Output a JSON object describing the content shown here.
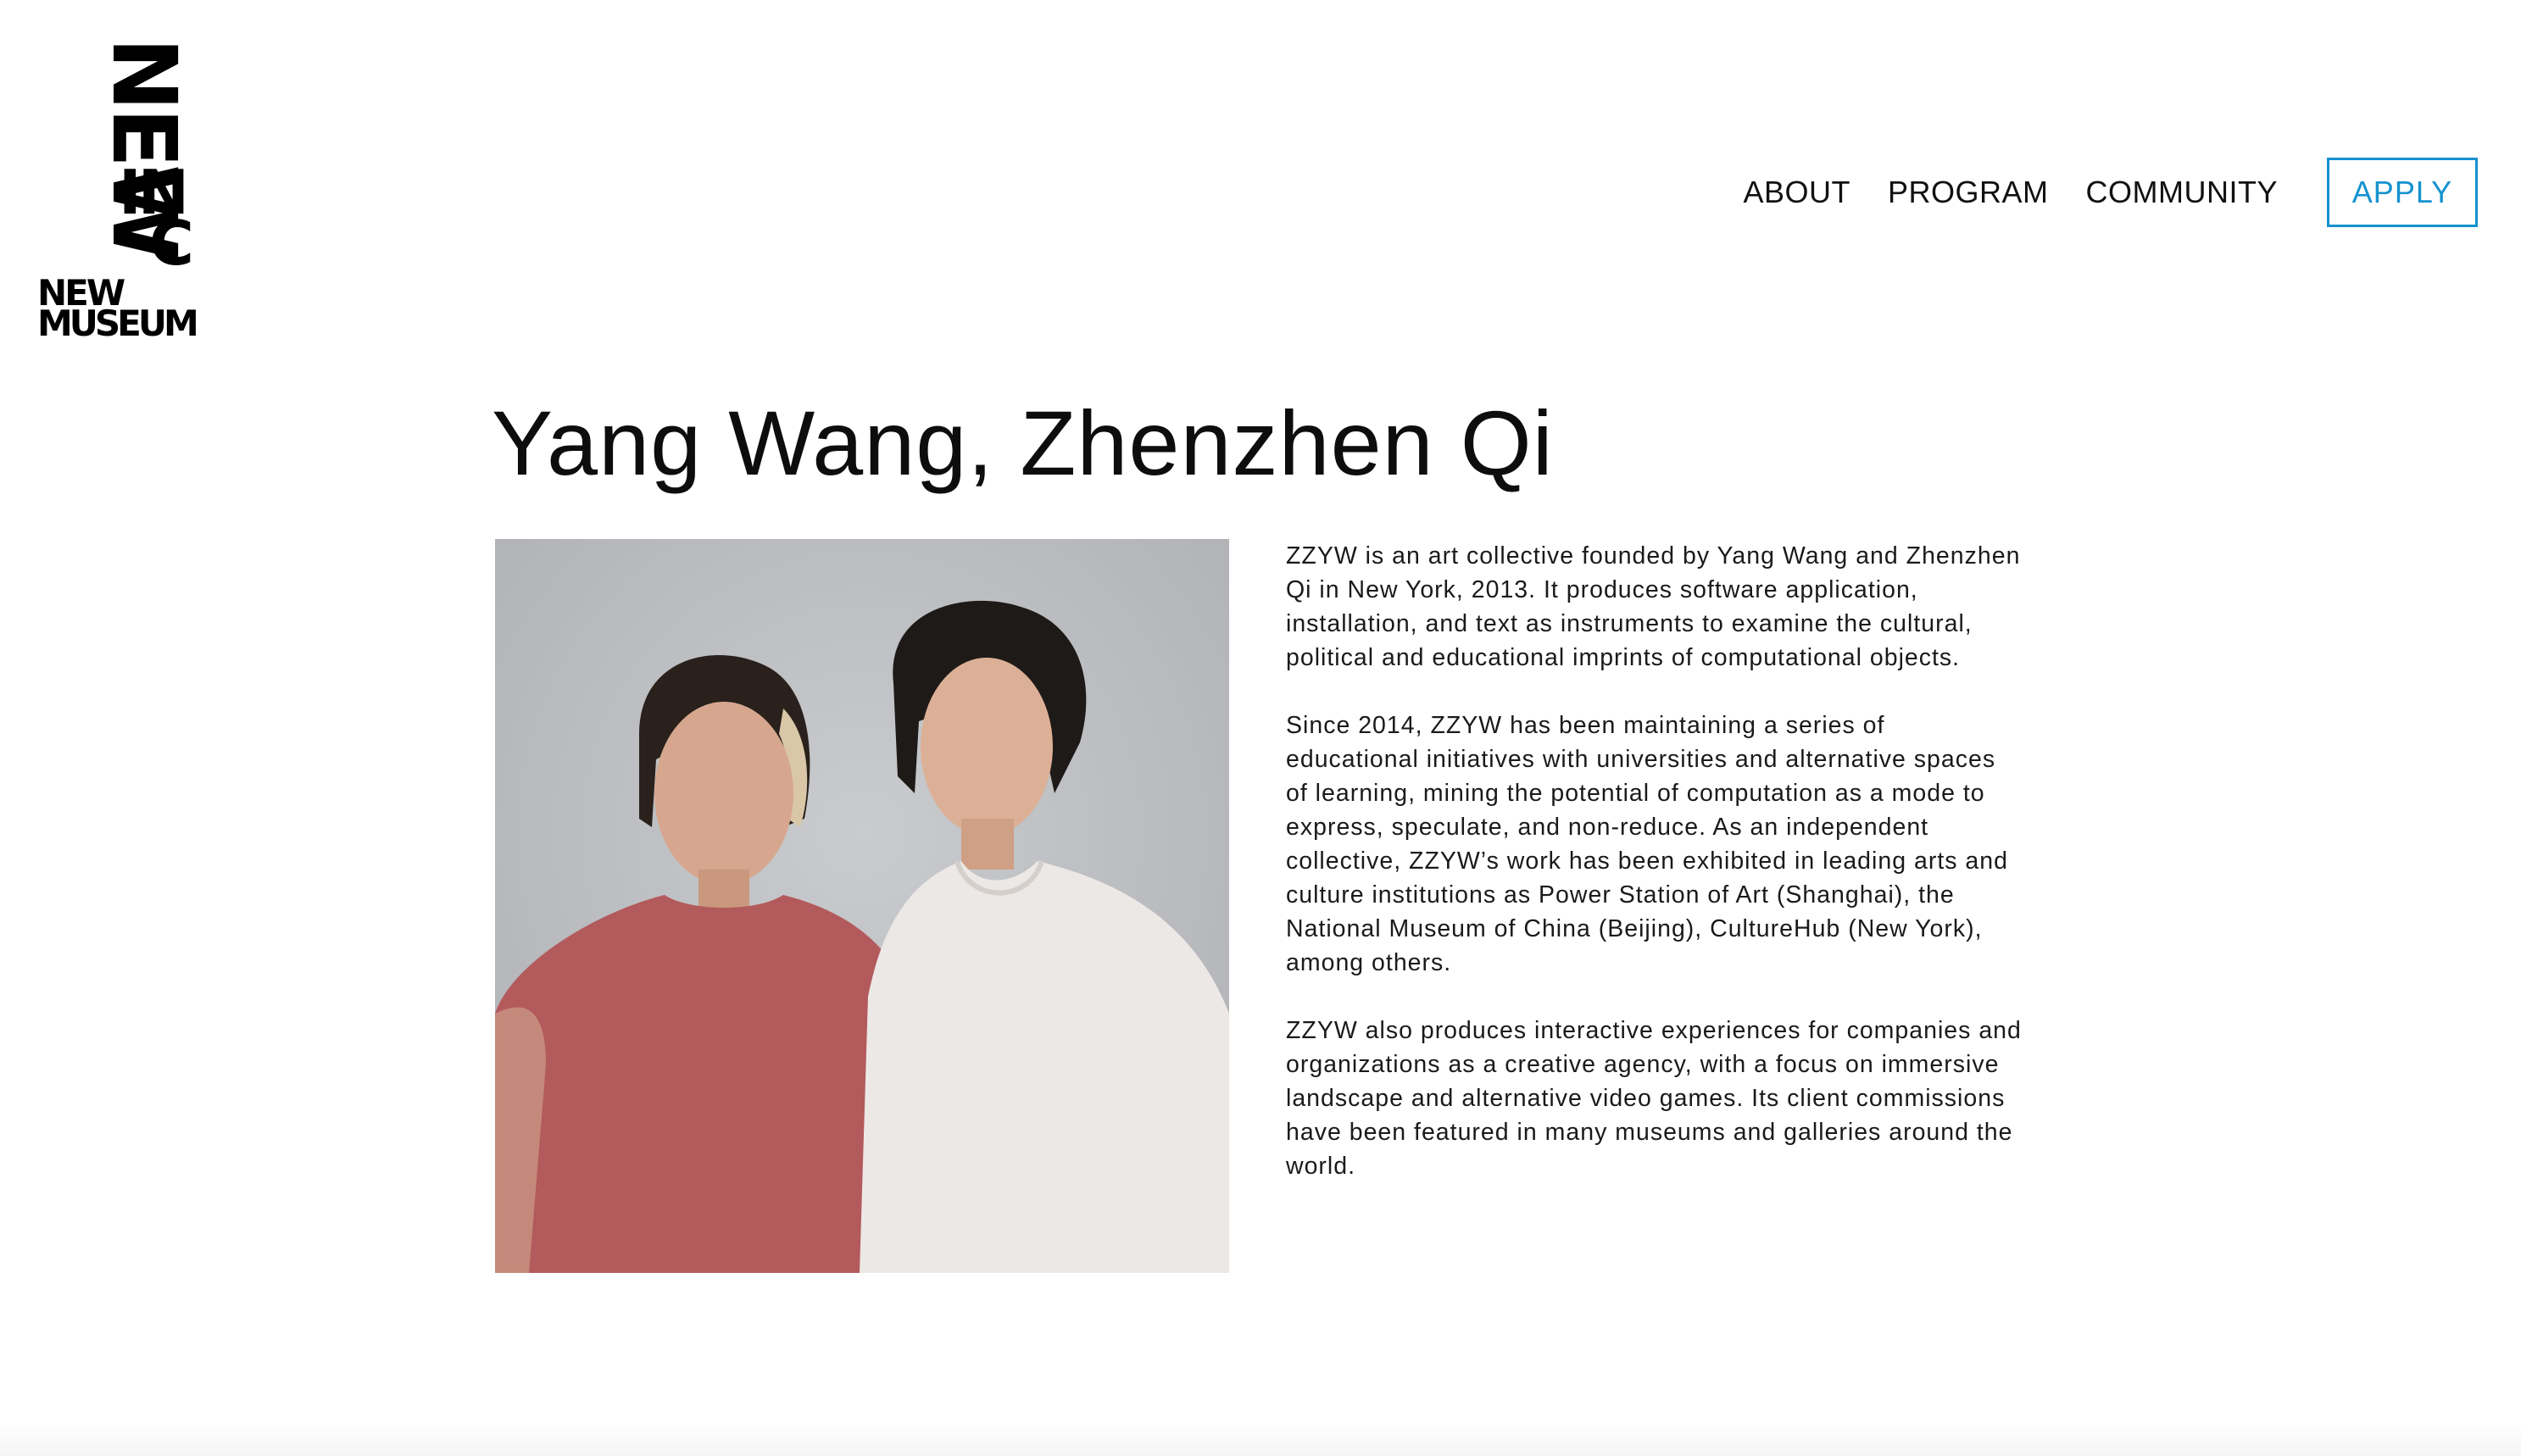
{
  "logo": {
    "text": "NEW INC NEW MUSEUM",
    "icon": "new-inc-logo-icon"
  },
  "nav": {
    "items": [
      {
        "label": "ABOUT"
      },
      {
        "label": "PROGRAM"
      },
      {
        "label": "COMMUNITY"
      }
    ],
    "apply_label": "APPLY"
  },
  "profile": {
    "name": "Yang Wang, Zhenzhen Qi",
    "bio": [
      "ZZYW is an art collective founded by Yang Wang and Zhenzhen Qi in New York, 2013. It produces software application, installation, and text as instruments to examine the cultural, political and educational imprints of computational objects.",
      "Since 2014, ZZYW has been maintaining a series of educational initiatives with universities and alternative spaces of learning, mining the potential of computation as a mode to express, speculate, and non-reduce. As an independent collective, ZZYW’s work has been exhibited in leading arts and culture institutions as Power Station of Art (Shanghai), the National Museum of China (Beijing), CultureHub (New York), among others.",
      "ZZYW also produces interactive experiences for companies and organizations as a creative agency, with a focus on immersive landscape and alternative video games. Its client commissions have been featured in many museums and galleries around the world."
    ]
  },
  "colors": {
    "accent": "#1592cf",
    "text": "#111111",
    "background": "#ffffff",
    "photo_backdrop": "#bbbdc1"
  }
}
